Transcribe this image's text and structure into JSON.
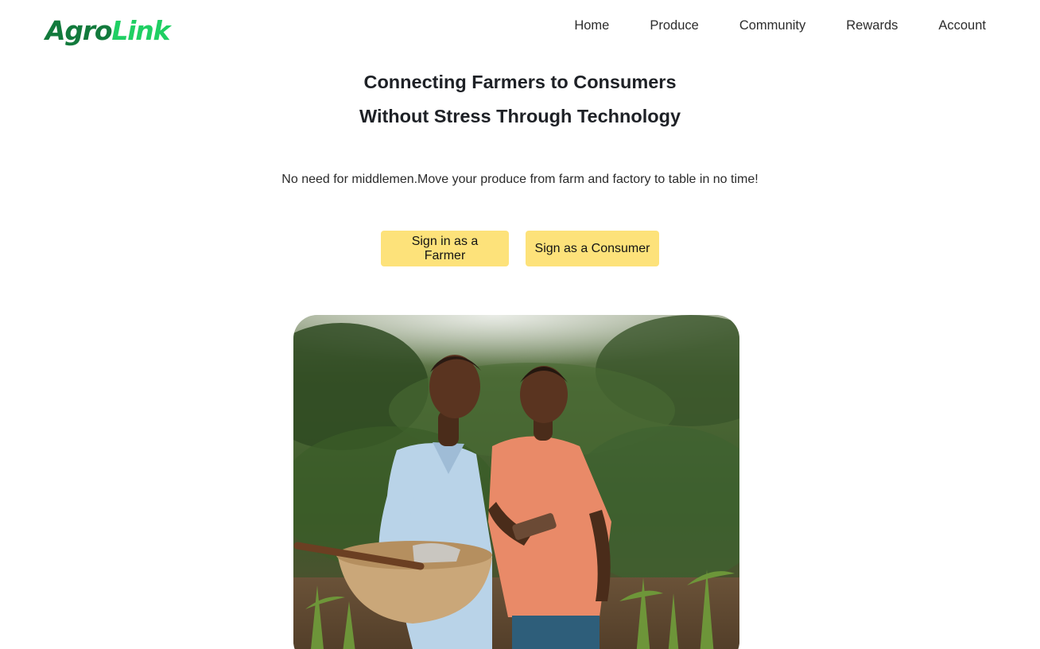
{
  "brand": {
    "logo_part_a": "Agro",
    "logo_part_b": "Link",
    "colors": {
      "primary_green": "#127a3c",
      "accent_green": "#1fcf63",
      "button_yellow": "#fde27a"
    }
  },
  "nav": {
    "items": [
      {
        "label": "Home"
      },
      {
        "label": "Produce"
      },
      {
        "label": "Community"
      },
      {
        "label": "Rewards"
      },
      {
        "label": "Account"
      }
    ]
  },
  "hero": {
    "title_line_1": "Connecting Farmers to Consumers",
    "title_line_2": "Without Stress Through Technology",
    "subtitle": "No need for middlemen.Move your produce from farm and factory to table in no time!",
    "buttons": {
      "farmer": "Sign in as a Farmer",
      "consumer": "Sign as a Consumer"
    }
  }
}
